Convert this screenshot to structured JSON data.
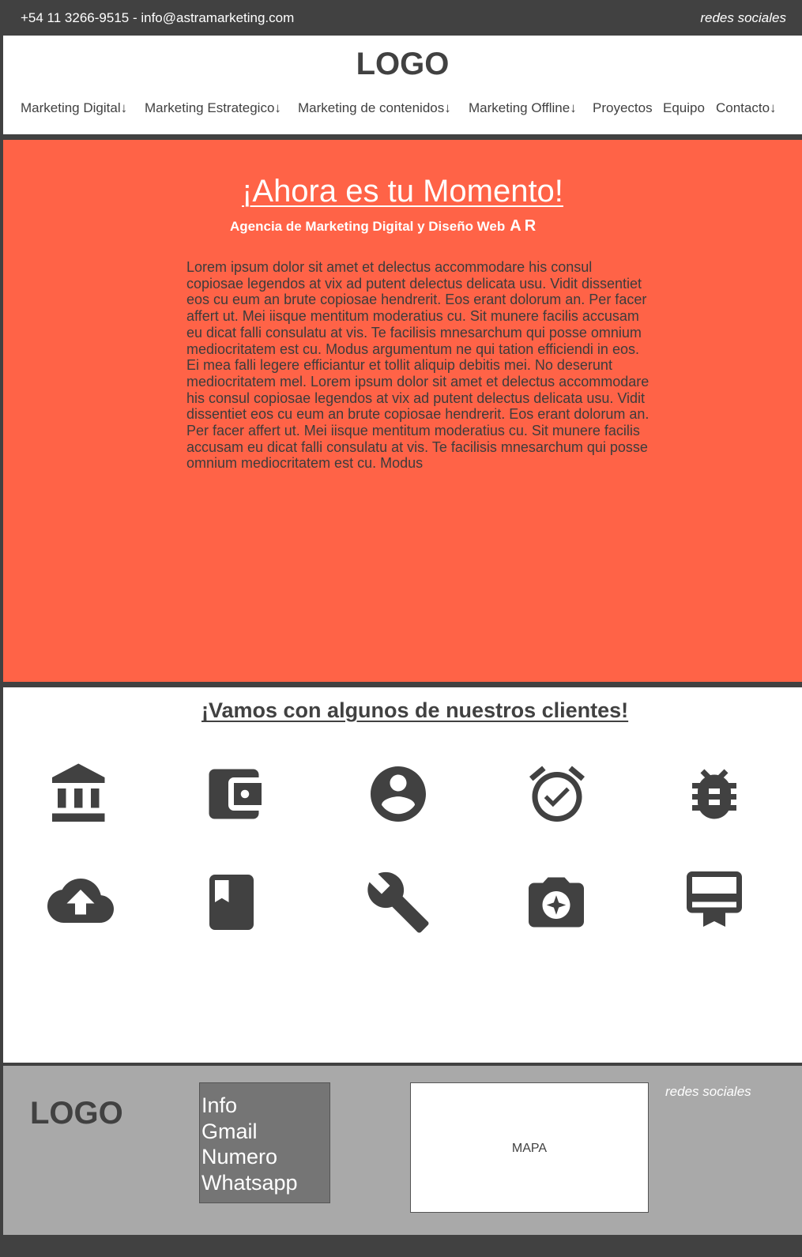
{
  "topbar": {
    "contact": "+54 11 3266-9515 - info@astramarketing.com",
    "social": "redes sociales"
  },
  "header": {
    "logo": "LOGO",
    "nav": [
      "Marketing Digital↓",
      "Marketing Estrategico↓",
      "Marketing de contenidos↓",
      "Marketing Offline↓",
      "Proyectos",
      "Equipo",
      "Contacto↓"
    ]
  },
  "hero": {
    "title": "¡Ahora es tu Momento!",
    "subtitle": "Agencia de Marketing Digital y Diseño Web",
    "subtitle_mark": "AR",
    "body": "Lorem ipsum dolor sit amet et delectus accommodare his consul copiosae legendos at vix ad putent delectus delicata usu. Vidit dissentiet eos cu eum an brute copiosae hendrerit. Eos erant dolorum an. Per facer affert ut. Mei iisque mentitum moderatius cu. Sit munere facilis accusam eu dicat falli consulatu at vis. Te facilisis mnesarchum qui posse omnium mediocritatem est cu. Modus argumentum ne qui tation efficiendi in eos. Ei mea falli legere efficiantur et tollit aliquip debitis mei. No deserunt mediocritatem mel. Lorem ipsum dolor sit amet et delectus accommodare his consul copiosae legendos at vix ad putent delectus delicata usu. Vidit dissentiet eos cu eum an brute copiosae hendrerit. Eos erant dolorum an. Per facer affert ut. Mei iisque mentitum moderatius cu. Sit munere facilis accusam eu dicat falli consulatu at vis. Te facilisis mnesarchum qui posse omnium mediocritatem est cu. Modus"
  },
  "clients": {
    "heading": "¡Vamos con algunos de nuestros clientes!",
    "icons": [
      "bank-icon",
      "wallet-icon",
      "user-circle-icon",
      "alarm-check-icon",
      "bug-icon",
      "cloud-upload-icon",
      "book-icon",
      "wrench-icon",
      "camera-icon",
      "card-membership-icon"
    ]
  },
  "footer": {
    "logo": "LOGO",
    "info": [
      "Info",
      "Gmail",
      "Numero",
      "Whatsapp"
    ],
    "map": "MAPA",
    "social": "redes sociales"
  },
  "colors": {
    "dark": "#414141",
    "accent": "#ff6347",
    "footer_bg": "#a9a9a9",
    "info_bg": "#757575"
  }
}
